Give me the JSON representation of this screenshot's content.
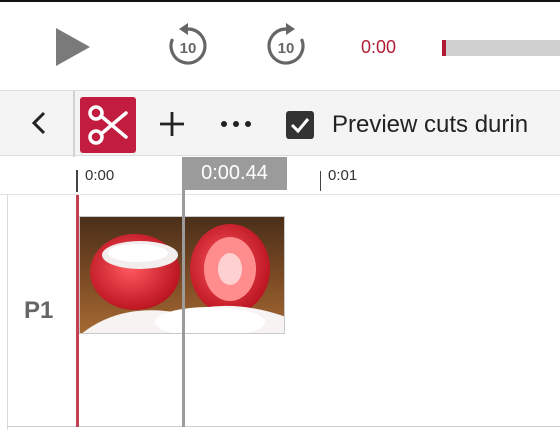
{
  "transport": {
    "play_icon": "play-icon",
    "skip_back_icon": "rewind-10-icon",
    "skip_back_label": "10",
    "skip_forward_icon": "forward-10-icon",
    "skip_forward_label": "10",
    "current_time": "0:00",
    "progress_fraction": 0.0
  },
  "toolbar": {
    "back_icon": "chevron-left-icon",
    "cut_icon": "scissors-icon",
    "add_icon": "plus-icon",
    "more_icon": "more-horizontal-icon",
    "preview_checked": true,
    "preview_label": "Preview cuts durin"
  },
  "ruler": {
    "labels": [
      "0:00",
      "0:01"
    ],
    "playhead_time": "0:00.44"
  },
  "track": {
    "label": "P1",
    "clip_thumbnail": "strawberries-with-sugar"
  },
  "colors": {
    "accent": "#c21d3f",
    "time_text": "#b01c35",
    "playhead": "#9b9b9b"
  }
}
